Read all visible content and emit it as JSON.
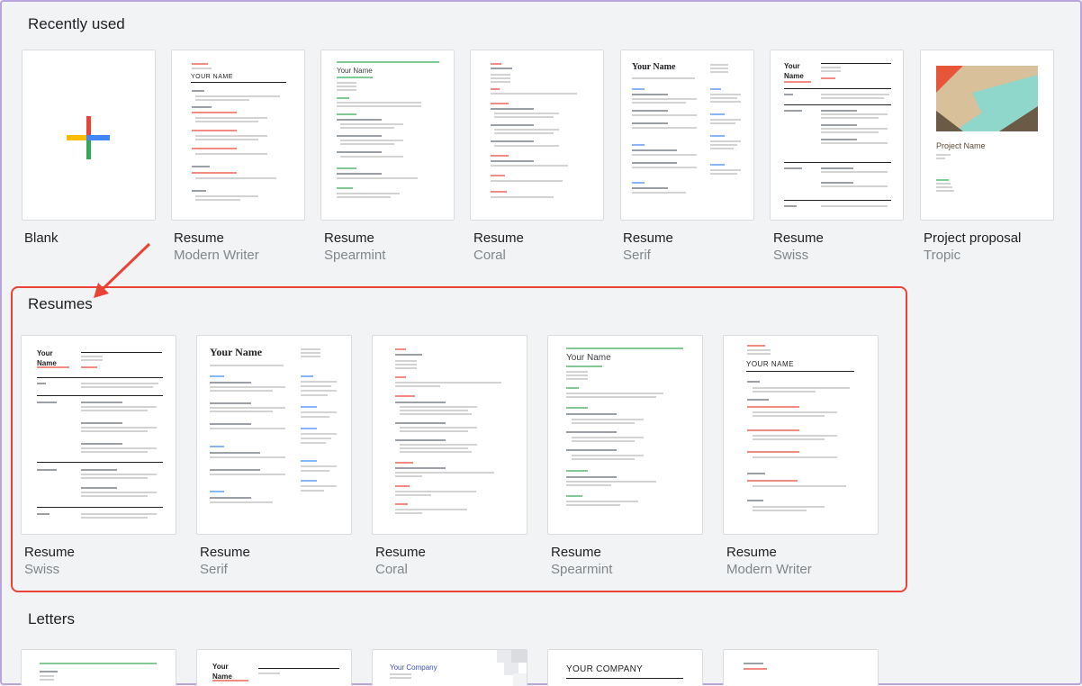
{
  "sections": {
    "recent": "Recently used",
    "resumes": "Resumes",
    "letters": "Letters"
  },
  "recent": [
    {
      "name": "Blank",
      "sub": ""
    },
    {
      "name": "Resume",
      "sub": "Modern Writer"
    },
    {
      "name": "Resume",
      "sub": "Spearmint"
    },
    {
      "name": "Resume",
      "sub": "Coral"
    },
    {
      "name": "Resume",
      "sub": "Serif"
    },
    {
      "name": "Resume",
      "sub": "Swiss"
    },
    {
      "name": "Project proposal",
      "sub": "Tropic"
    }
  ],
  "resumes": [
    {
      "name": "Resume",
      "sub": "Swiss"
    },
    {
      "name": "Resume",
      "sub": "Serif"
    },
    {
      "name": "Resume",
      "sub": "Coral"
    },
    {
      "name": "Resume",
      "sub": "Spearmint"
    },
    {
      "name": "Resume",
      "sub": "Modern Writer"
    }
  ],
  "thumbs": {
    "your_name": "Your Name",
    "your_name_caps": "YOUR NAME",
    "project_name": "Project Name",
    "your_company": "Your Company",
    "your_company_caps": "YOUR COMPANY",
    "your_name_bold": "Your\nName"
  },
  "colors": {
    "highlight": "#ea4335",
    "frame": "#b9a4dc"
  }
}
